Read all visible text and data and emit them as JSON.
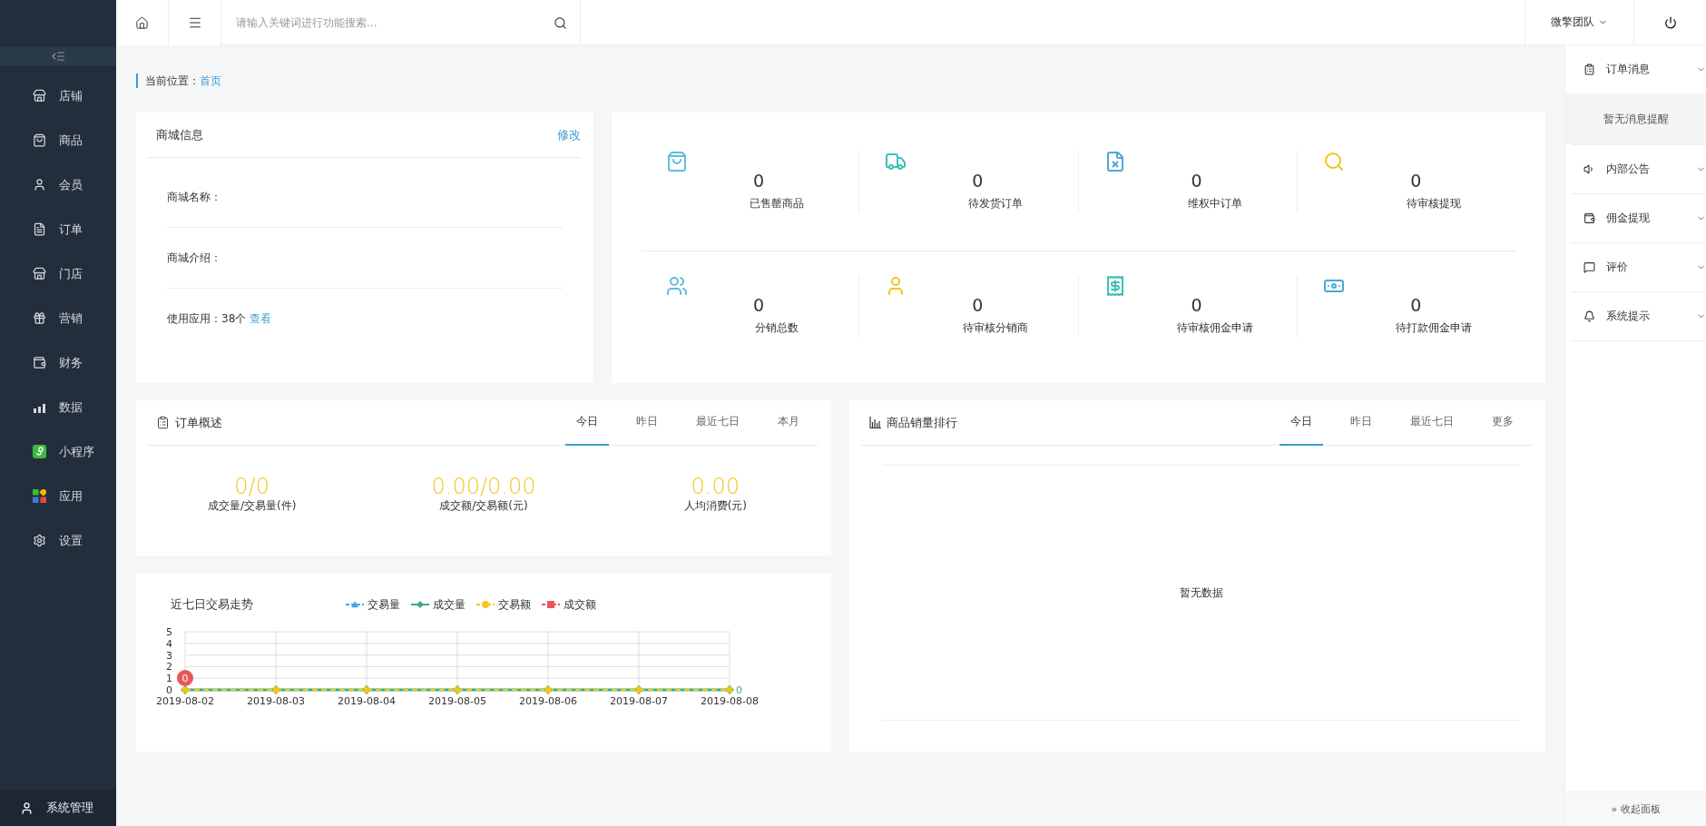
{
  "topbar": {
    "search": {
      "placeholder": "请输入关键词进行功能搜索..."
    },
    "user": "微擎团队"
  },
  "sidebar": {
    "items": [
      {
        "label": "店铺",
        "kind": "store"
      },
      {
        "label": "商品",
        "kind": "bag"
      },
      {
        "label": "会员",
        "kind": "user"
      },
      {
        "label": "订单",
        "kind": "document"
      },
      {
        "label": "门店",
        "kind": "shop"
      },
      {
        "label": "营销",
        "kind": "gift"
      },
      {
        "label": "财务",
        "kind": "wallet"
      },
      {
        "label": "数据",
        "kind": "chart"
      },
      {
        "label": "小程序",
        "kind": "miniprogram"
      },
      {
        "label": "应用",
        "kind": "apps"
      },
      {
        "label": "设置",
        "kind": "settings"
      }
    ],
    "footer": "系统管理"
  },
  "breadcrumb": {
    "label": "当前位置：",
    "current": "首页"
  },
  "shop_info": {
    "title": "商城信息",
    "edit": "修改",
    "fields": [
      {
        "label": "商城名称："
      },
      {
        "label": "商城介绍："
      }
    ],
    "apps": {
      "label": "使用应用：",
      "value": "38个",
      "link": "查看"
    }
  },
  "stats": [
    [
      {
        "value": "0",
        "label": "已售罄商品",
        "kind": "bag",
        "color": "#5bbfdc"
      },
      {
        "value": "0",
        "label": "待发货订单",
        "kind": "truck",
        "color": "#3cc3b6"
      },
      {
        "value": "0",
        "label": "维权中订单",
        "kind": "filex",
        "color": "#4aa8d8"
      },
      {
        "value": "0",
        "label": "待审核提现",
        "kind": "search",
        "color": "#f3c21b"
      }
    ],
    [
      {
        "value": "0",
        "label": "分销总数",
        "kind": "users",
        "color": "#5bbfdc"
      },
      {
        "value": "0",
        "label": "待审核分销商",
        "kind": "user",
        "color": "#f3c21b"
      },
      {
        "value": "0",
        "label": "待审核佣金申请",
        "kind": "receipt",
        "color": "#3cc3b6"
      },
      {
        "value": "0",
        "label": "待打款佣金申请",
        "kind": "atm",
        "color": "#4aa8d8"
      }
    ]
  ],
  "order_overview": {
    "title": "订单概述",
    "tabs": [
      {
        "label": "今日",
        "selected": true
      },
      {
        "label": "昨日",
        "selected": false
      },
      {
        "label": "最近七日",
        "selected": false
      },
      {
        "label": "本月",
        "selected": false
      }
    ],
    "metrics": [
      {
        "value": "0/0",
        "label": "成交量/交易量(件)"
      },
      {
        "value": "0.00/0.00",
        "label": "成交额/交易额(元)"
      },
      {
        "value": "0.00",
        "label": "人均消费(元)"
      }
    ]
  },
  "trend": {
    "chart_data": {
      "type": "line",
      "title": "近七日交易走势",
      "categories": [
        "2019-08-02",
        "2019-08-03",
        "2019-08-04",
        "2019-08-05",
        "2019-08-06",
        "2019-08-07",
        "2019-08-08"
      ],
      "ylim": [
        0,
        5
      ],
      "yticks": [
        0,
        1,
        2,
        3,
        4,
        5
      ],
      "grid": true,
      "legend": "top",
      "series": [
        {
          "name": "交易量",
          "color": "#4aa3df",
          "marker": "triangle",
          "line_style": "dashed",
          "values": [
            null,
            null,
            null,
            null,
            null,
            null,
            null
          ]
        },
        {
          "name": "成交量",
          "color": "#3bab87",
          "marker": "diamond",
          "line_style": "solid",
          "values": [
            0,
            0,
            0,
            0,
            0,
            0,
            0
          ]
        },
        {
          "name": "交易额",
          "color": "#f5c518",
          "marker": "circle",
          "line_style": "dashed",
          "values": [
            0,
            0,
            0,
            0,
            0,
            0,
            0
          ]
        },
        {
          "name": "成交额",
          "color": "#e9575a",
          "marker": "square",
          "line_style": "dashed",
          "values": [
            null,
            null,
            null,
            null,
            null,
            null,
            null
          ]
        }
      ],
      "annotations": [
        {
          "x": "2019-08-02",
          "y": 0,
          "text": "0"
        },
        {
          "x": "2019-08-08",
          "y": 0,
          "text": "0"
        }
      ]
    }
  },
  "ranking": {
    "title": "商品销量排行",
    "tabs": [
      {
        "label": "今日",
        "selected": true
      },
      {
        "label": "昨日",
        "selected": false
      },
      {
        "label": "最近七日",
        "selected": false
      },
      {
        "label": "更多",
        "selected": false
      }
    ],
    "empty": "暂无数据"
  },
  "panel": {
    "sections": [
      {
        "title": "订单消息",
        "kind": "clipboard",
        "expanded": true,
        "body": "暂无消息提醒"
      },
      {
        "title": "内部公告",
        "kind": "speaker",
        "expanded": false
      },
      {
        "title": "佣金提现",
        "kind": "wallet",
        "expanded": false
      },
      {
        "title": "评价",
        "kind": "comment",
        "expanded": false
      },
      {
        "title": "系统提示",
        "kind": "bell",
        "expanded": false
      }
    ],
    "collapse": "» 收起面板"
  }
}
